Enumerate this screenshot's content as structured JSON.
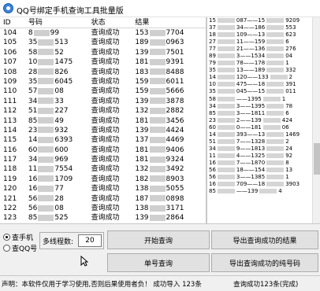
{
  "window": {
    "title": "QQ号绑定手机查询工具批量版"
  },
  "table": {
    "headers": [
      "ID",
      "号码",
      "状态",
      "结果"
    ],
    "rows": [
      {
        "id": "104",
        "num_a": "8",
        "num_b": "99",
        "status": "查询成功",
        "res_a": "153",
        "res_b": "7704"
      },
      {
        "id": "105",
        "num_a": "35",
        "num_b": "513",
        "status": "查询成功",
        "res_a": "189",
        "res_b": "0963"
      },
      {
        "id": "106",
        "num_a": "58",
        "num_b": "52",
        "status": "查询成功",
        "res_a": "139",
        "res_b": "7501"
      },
      {
        "id": "107",
        "num_a": "10",
        "num_b": "1475",
        "status": "查询成功",
        "res_a": "181",
        "res_b": "9391"
      },
      {
        "id": "108",
        "num_a": "28",
        "num_b": "826",
        "status": "查询成功",
        "res_a": "183",
        "res_b": "8488"
      },
      {
        "id": "109",
        "num_a": "35",
        "num_b": "6045",
        "status": "查询成功",
        "res_a": "159",
        "res_b": "6011"
      },
      {
        "id": "110",
        "num_a": "57",
        "num_b": "08",
        "status": "查询成功",
        "res_a": "159",
        "res_b": "5666"
      },
      {
        "id": "111",
        "num_a": "34",
        "num_b": "33",
        "status": "查询成功",
        "res_a": "139",
        "res_b": "3878"
      },
      {
        "id": "112",
        "num_a": "51",
        "num_b": "227",
        "status": "查询成功",
        "res_a": "132",
        "res_b": "2882"
      },
      {
        "id": "113",
        "num_a": "85",
        "num_b": "49",
        "status": "查询成功",
        "res_a": "181",
        "res_b": "3456"
      },
      {
        "id": "114",
        "num_a": "23",
        "num_b": "932",
        "status": "查询成功",
        "res_a": "139",
        "res_b": "4424"
      },
      {
        "id": "115",
        "num_a": "14",
        "num_b": "6393",
        "status": "查询成功",
        "res_a": "137",
        "res_b": "4469"
      },
      {
        "id": "116",
        "num_a": "60",
        "num_b": "600",
        "status": "查询成功",
        "res_a": "181",
        "res_b": "9406"
      },
      {
        "id": "117",
        "num_a": "34",
        "num_b": "969",
        "status": "查询成功",
        "res_a": "181",
        "res_b": "9324"
      },
      {
        "id": "118",
        "num_a": "11",
        "num_b": "7554",
        "status": "查询成功",
        "res_a": "132",
        "res_b": "3492"
      },
      {
        "id": "119",
        "num_a": "16",
        "num_b": "1709",
        "status": "查询成功",
        "res_a": "182",
        "res_b": "8903"
      },
      {
        "id": "120",
        "num_a": "16",
        "num_b": "77",
        "status": "查询成功",
        "res_a": "138",
        "res_b": "5055"
      },
      {
        "id": "121",
        "num_a": "56",
        "num_b": "28",
        "status": "查询成功",
        "res_a": "187",
        "res_b": "0898"
      },
      {
        "id": "122",
        "num_a": "56",
        "num_b": "08",
        "status": "查询成功",
        "res_a": "138",
        "res_b": "3171"
      },
      {
        "id": "123",
        "num_a": "85",
        "num_b": "525",
        "status": "查询成功",
        "res_a": "139",
        "res_b": "2864"
      }
    ]
  },
  "side_list": [
    {
      "a": "15",
      "b": "087",
      "c": "15",
      "d": "9209"
    },
    {
      "a": "37",
      "b": "34",
      "c": "186",
      "d": "553"
    },
    {
      "a": "18",
      "b": "109",
      "c": "13",
      "d": "623"
    },
    {
      "a": "27",
      "b": "11",
      "c": "159",
      "d": "6"
    },
    {
      "a": "77",
      "b": "21",
      "c": "136",
      "d": "276"
    },
    {
      "a": "89",
      "b": "3",
      "c": "1534",
      "d": "04"
    },
    {
      "a": "79",
      "b": "78",
      "c": "178",
      "d": "1"
    },
    {
      "a": "35",
      "b": "13",
      "c": "189",
      "d": "332"
    },
    {
      "a": "14",
      "b": "120",
      "c": "133",
      "d": "2"
    },
    {
      "a": "10",
      "b": "475",
      "c": "18",
      "d": "391"
    },
    {
      "a": "35",
      "b": "045",
      "c": "15",
      "d": "011"
    },
    {
      "a": "58",
      "b": "",
      "c": "1395",
      "d": "1"
    },
    {
      "a": "34",
      "b": "3",
      "c": "1395",
      "d": "78"
    },
    {
      "a": "85",
      "b": "3",
      "c": "1811",
      "d": "6"
    },
    {
      "a": "23",
      "b": "2",
      "c": "139",
      "d": "424"
    },
    {
      "a": "60",
      "b": "0",
      "c": "181",
      "d": "06"
    },
    {
      "a": "14",
      "b": "393",
      "c": "13",
      "d": "1469"
    },
    {
      "a": "51",
      "b": "7",
      "c": "1328",
      "d": "2"
    },
    {
      "a": "34",
      "b": "9",
      "c": "1813",
      "d": "24"
    },
    {
      "a": "11",
      "b": "4",
      "c": "1325",
      "d": "92"
    },
    {
      "a": "16",
      "b": "7",
      "c": "1870",
      "d": "8"
    },
    {
      "a": "56",
      "b": "18",
      "c": "154",
      "d": "13"
    },
    {
      "a": "56",
      "b": "3",
      "c": "1385",
      "d": "1"
    },
    {
      "a": "16",
      "b": "709",
      "c": "18",
      "d": "3903"
    },
    {
      "a": "85",
      "b": "",
      "c": "139",
      "d": "4"
    }
  ],
  "controls": {
    "radio_phone": "查手机",
    "radio_qq": "查QQ号",
    "thread_label": "多线程数:",
    "thread_value": "20",
    "start_btn": "开始查询",
    "export_btn": "导出查询成功的结果",
    "single_btn": "单号查询",
    "export_pure_btn": "导出查询成功的纯号码"
  },
  "status": {
    "left": "声明：本软件仅用于学习使用,否则后果使用者负！ 成功导入  123条",
    "right": "查询成功123条(完成)"
  }
}
